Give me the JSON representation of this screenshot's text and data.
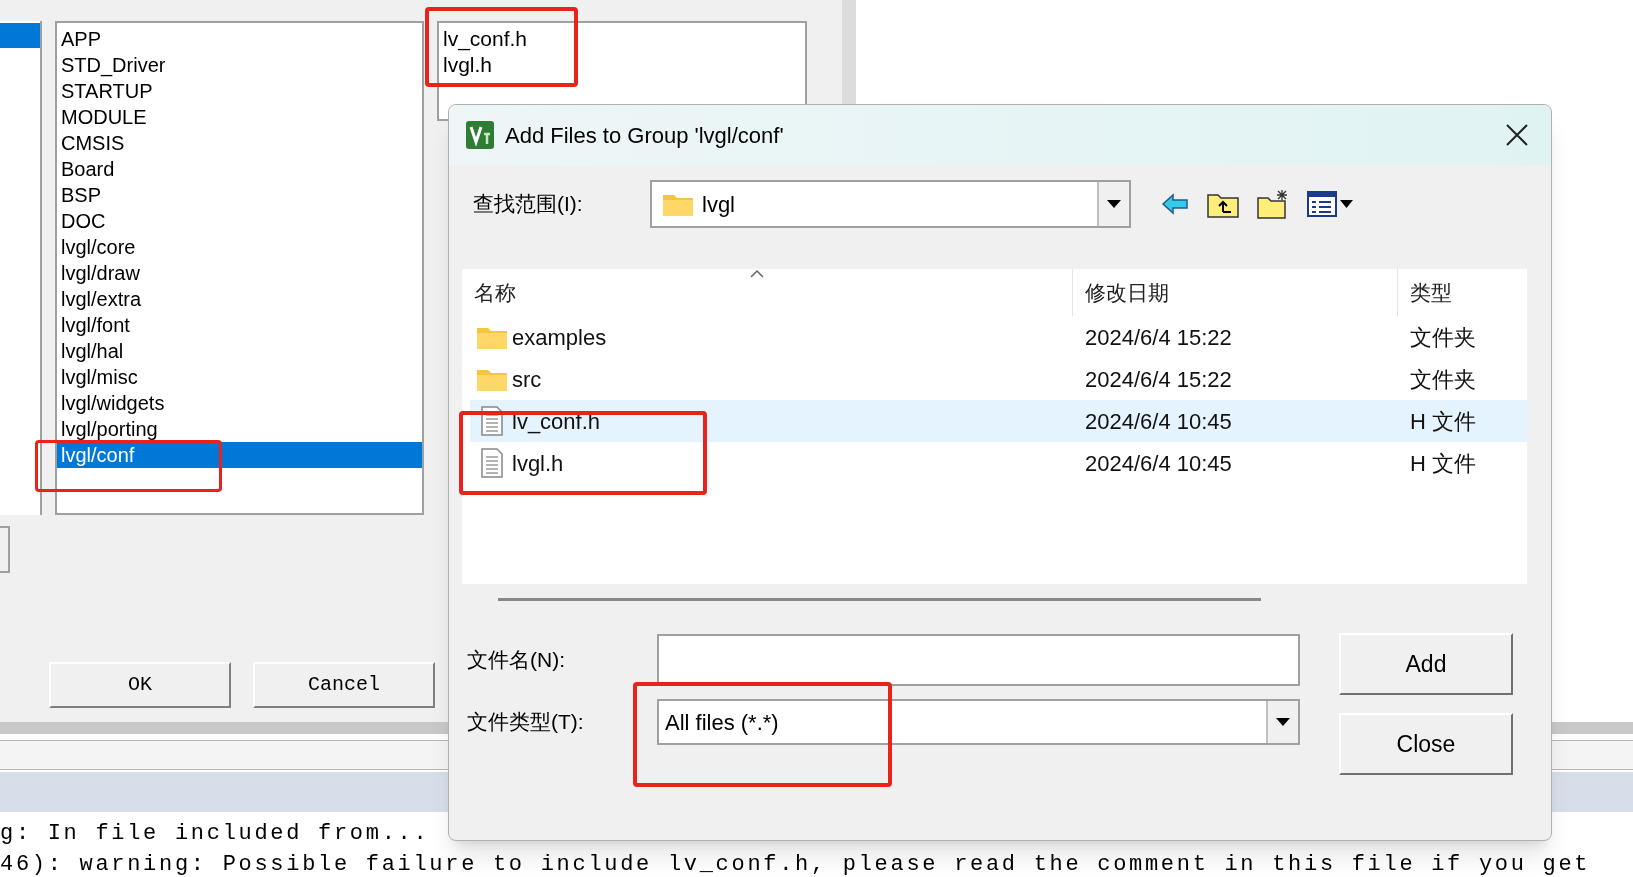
{
  "groups_list": {
    "items": [
      {
        "label": "APP",
        "selected": false
      },
      {
        "label": "STD_Driver",
        "selected": false
      },
      {
        "label": "STARTUP",
        "selected": false
      },
      {
        "label": "MODULE",
        "selected": false
      },
      {
        "label": "CMSIS",
        "selected": false
      },
      {
        "label": "Board",
        "selected": false
      },
      {
        "label": "BSP",
        "selected": false
      },
      {
        "label": "DOC",
        "selected": false
      },
      {
        "label": "lvgl/core",
        "selected": false
      },
      {
        "label": "lvgl/draw",
        "selected": false
      },
      {
        "label": "lvgl/extra",
        "selected": false
      },
      {
        "label": "lvgl/font",
        "selected": false
      },
      {
        "label": "lvgl/hal",
        "selected": false
      },
      {
        "label": "lvgl/misc",
        "selected": false
      },
      {
        "label": "lvgl/widgets",
        "selected": false
      },
      {
        "label": "lvgl/porting",
        "selected": false
      },
      {
        "label": "lvgl/conf",
        "selected": true
      }
    ]
  },
  "files_list": {
    "items": [
      "lv_conf.h",
      "lvgl.h"
    ]
  },
  "buttons": [
    "OK",
    "Cancel"
  ],
  "dialog": {
    "title": "Add Files to Group 'lvgl/conf'",
    "look_in_label": "查找范围(I):",
    "look_in_value": "lvgl",
    "columns": [
      "名称",
      "修改日期",
      "类型"
    ],
    "rows": [
      {
        "kind": "folder",
        "name": "examples",
        "date": "2024/6/4 15:22",
        "type": "文件夹",
        "selected": false
      },
      {
        "kind": "folder",
        "name": "src",
        "date": "2024/6/4 15:22",
        "type": "文件夹",
        "selected": false
      },
      {
        "kind": "file",
        "name": "lv_conf.h",
        "date": "2024/6/4 10:45",
        "type": "H 文件",
        "selected": true
      },
      {
        "kind": "file",
        "name": "lvgl.h",
        "date": "2024/6/4 10:45",
        "type": "H 文件",
        "selected": false
      }
    ],
    "file_name_label": "文件名(N):",
    "file_type_label": "文件类型(T):",
    "file_type_value": "All files (*.*)",
    "buttons": [
      "Add",
      "Close"
    ]
  },
  "console": {
    "lines": [
      "g: In file included from...",
      "46): warning: Possible failure to include lv_conf.h, please read the comment in this file if you get"
    ]
  }
}
